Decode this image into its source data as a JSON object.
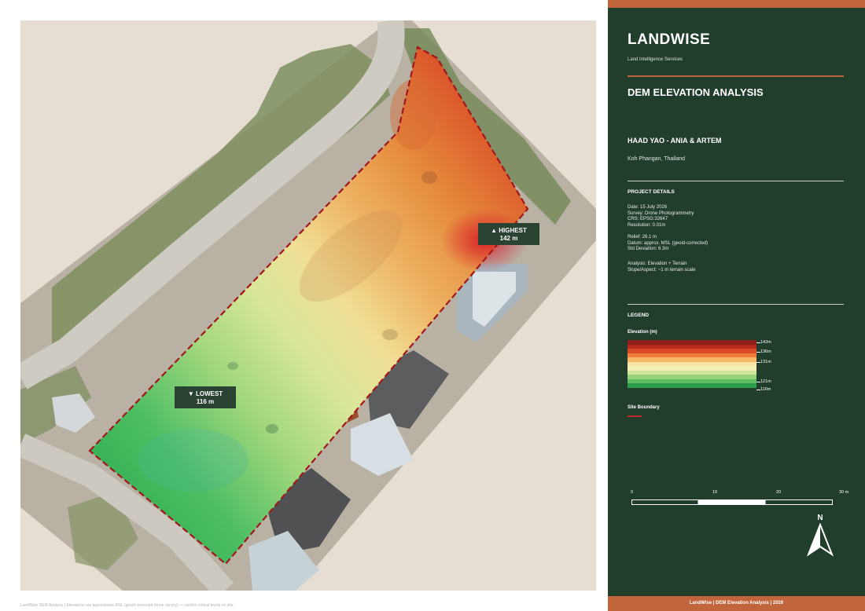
{
  "map": {
    "highest_label": "▲ HIGHEST",
    "highest_value": "142 m",
    "lowest_label": "▼ LOWEST",
    "lowest_value": "116 m",
    "boundary_color": "#a3161c",
    "elevation_range_m": [
      116,
      142
    ]
  },
  "footer_note": "LandWise DEM Analysis | Elevations are approximate MSL (geoid-corrected drone survey) — confirm critical levels on site.",
  "panel": {
    "brand": "LANDWISE",
    "brand_sub": "Land Intelligence Services",
    "doc_title": "DEM ELEVATION ANALYSIS",
    "project_name": "HAAD YAO - ANIA & ARTEM",
    "project_location": "Koh Phangan, Thailand",
    "details_heading": "PROJECT DETAILS",
    "details_group1": [
      "Date:  15 July 2026",
      "Survey:  Drone Photogrammetry",
      "CRS:  EPSG:32647",
      "Resolution:  0.01m"
    ],
    "details_group2": [
      "Relief:  26.1 m",
      "Datum:  approx. MSL (geoid-corrected)",
      "Std Deviation:  6.3m"
    ],
    "details_group3": [
      "Analysis:  Elevation + Terrain",
      "Slope/Aspect:  ~1 m terrain scale"
    ],
    "legend_heading": "LEGEND",
    "elevation_heading": "Elevation (m)",
    "legend_ticks": [
      "142m",
      "136m",
      "131m",
      "121m",
      "116m"
    ],
    "legend_colors": [
      "#8e1f1b",
      "#b72a1f",
      "#d94a26",
      "#ef7f3a",
      "#f7b868",
      "#fbe3a5",
      "#f3f1b4",
      "#cfe69c",
      "#96d27a",
      "#5ebd63",
      "#2f9e4c"
    ],
    "boundary_heading": "Site Boundary",
    "boundary_color": "#c0272d",
    "scale_labels": [
      "0",
      "10",
      "20",
      "30 m"
    ],
    "north_label": "N",
    "footer": "LandWise  |  DEM Elevation Analysis  |  2026",
    "accent_color": "#c2653c",
    "panel_color": "#213d2c"
  }
}
